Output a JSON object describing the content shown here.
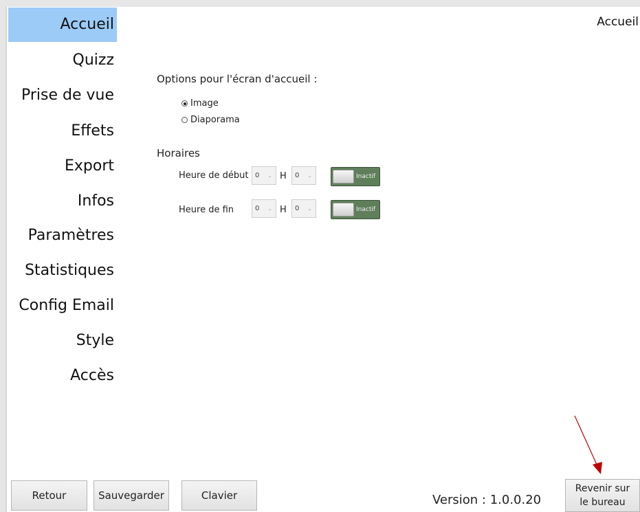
{
  "header": {
    "title": "Accueil"
  },
  "sidebar": {
    "items": [
      {
        "label": "Accueil",
        "active": true
      },
      {
        "label": "Quizz"
      },
      {
        "label": "Prise de vue"
      },
      {
        "label": "Effets"
      },
      {
        "label": "Export"
      },
      {
        "label": "Infos"
      },
      {
        "label": "Paramètres"
      },
      {
        "label": "Statistiques"
      },
      {
        "label": "Config Email"
      },
      {
        "label": "Style"
      },
      {
        "label": "Accès"
      }
    ]
  },
  "home_options": {
    "title": "Options pour l'écran d'accueil :",
    "radios": [
      {
        "label": "Image",
        "checked": true
      },
      {
        "label": "Diaporama",
        "checked": false
      }
    ]
  },
  "schedule": {
    "title": "Horaires",
    "separator": "H",
    "rows": [
      {
        "label": "Heure de début",
        "hour": "0",
        "minute": "0",
        "toggle": "Inactif"
      },
      {
        "label": "Heure de fin",
        "hour": "0",
        "minute": "0",
        "toggle": "Inactif"
      }
    ]
  },
  "footer": {
    "back": "Retour",
    "save": "Sauvegarder",
    "keyboard": "Clavier",
    "version": "Version : 1.0.0.20",
    "desktop_line1": "Revenir sur",
    "desktop_line2": "le bureau"
  },
  "colors": {
    "active_nav": "#9ccbf7",
    "toggle_bg": "#5f7f5a",
    "annotation_arrow": "#c00000"
  }
}
